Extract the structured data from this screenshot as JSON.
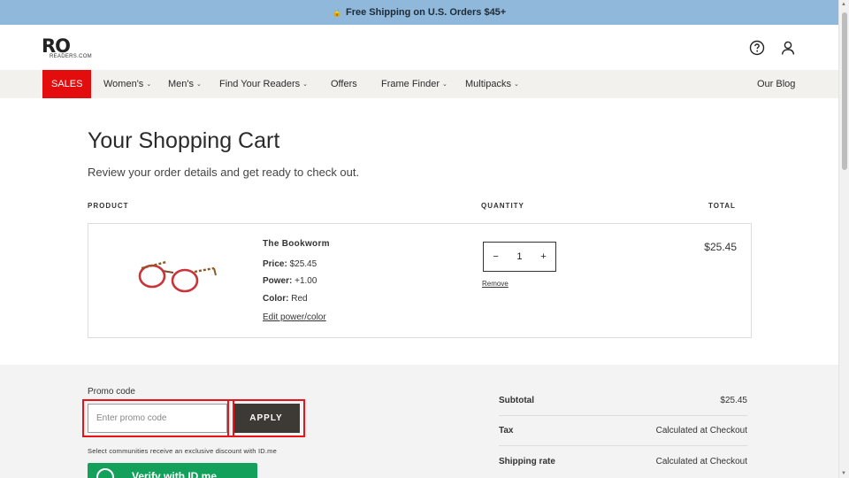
{
  "announcement": {
    "icon": "lock-icon",
    "text": "Free Shipping on U.S. Orders $45+"
  },
  "logo": {
    "mark": "RO",
    "sub": "READERS.COM"
  },
  "header_icons": [
    "help-circle-icon",
    "account-icon"
  ],
  "nav": {
    "sales": "SALES",
    "items": [
      {
        "label": "Women's",
        "dropdown": true
      },
      {
        "label": "Men's",
        "dropdown": true
      },
      {
        "label": "Find Your Readers",
        "dropdown": true
      },
      {
        "label": "Offers",
        "dropdown": false
      },
      {
        "label": "Frame Finder",
        "dropdown": true
      },
      {
        "label": "Multipacks",
        "dropdown": true
      }
    ],
    "blog": "Our Blog"
  },
  "page": {
    "title": "Your Shopping Cart",
    "subtitle": "Review your order details and get ready to check out."
  },
  "columns": {
    "product": "PRODUCT",
    "quantity": "QUANTITY",
    "total": "TOTAL"
  },
  "cart_item": {
    "name": "The Bookworm",
    "price_label": "Price:",
    "price": "$25.45",
    "power_label": "Power:",
    "power": "+1.00",
    "color_label": "Color:",
    "color": "Red",
    "edit": "Edit power/color",
    "qty_minus": "−",
    "qty": "1",
    "qty_plus": "+",
    "remove": "Remove",
    "line_total": "$25.45",
    "frame_color": "#c8343a"
  },
  "promo": {
    "label": "Promo code",
    "placeholder": "Enter promo code",
    "apply": "APPLY",
    "idme_note": "Select communities receive an exclusive discount with ID.me",
    "idme_button": "Verify with ID.me",
    "idme_color": "#13a05a"
  },
  "summary": {
    "subtotal_label": "Subtotal",
    "subtotal": "$25.45",
    "tax_label": "Tax",
    "tax": "Calculated at Checkout",
    "shipping_label": "Shipping rate",
    "shipping": "Calculated at Checkout"
  },
  "colors": {
    "announcement_bg": "#8fb8db",
    "sales_bg": "#e40d0d",
    "apply_bg": "#3d3935",
    "highlight": "#e8141a"
  }
}
